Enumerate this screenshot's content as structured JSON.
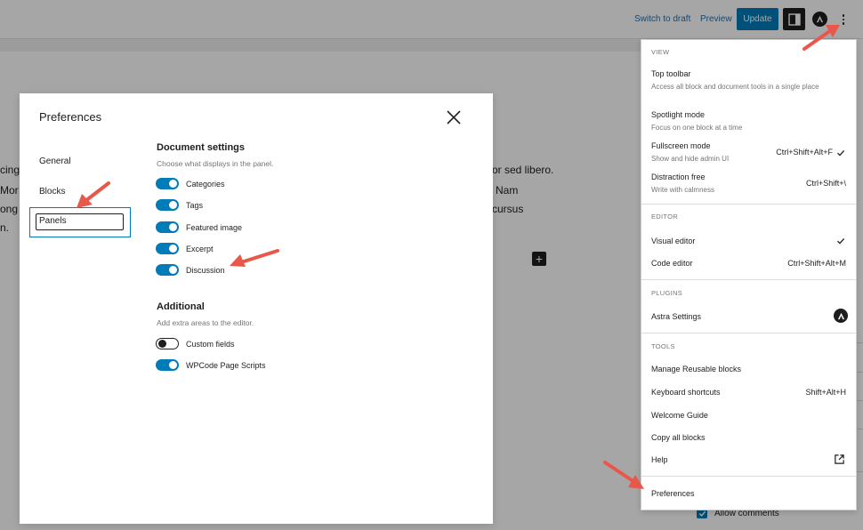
{
  "topbar": {
    "switch_to_draft": "Switch to draft",
    "preview": "Preview",
    "update": "Update"
  },
  "canvas": {
    "left_fragments": [
      "cing",
      "Mor",
      "ong",
      "n."
    ],
    "right_fragments": [
      "or sed libero.",
      "Nam",
      "cursus"
    ],
    "allow_comments": "Allow comments"
  },
  "modal": {
    "title": "Preferences",
    "nav": {
      "general": "General",
      "blocks": "Blocks",
      "panels": "Panels"
    },
    "document_settings": {
      "title": "Document settings",
      "description": "Choose what displays in the panel.",
      "toggles": [
        {
          "label": "Categories",
          "on": true
        },
        {
          "label": "Tags",
          "on": true
        },
        {
          "label": "Featured image",
          "on": true
        },
        {
          "label": "Excerpt",
          "on": true
        },
        {
          "label": "Discussion",
          "on": true
        }
      ]
    },
    "additional": {
      "title": "Additional",
      "description": "Add extra areas to the editor.",
      "toggles": [
        {
          "label": "Custom fields",
          "on": false
        },
        {
          "label": "WPCode Page Scripts",
          "on": true
        }
      ]
    }
  },
  "menu": {
    "view": {
      "heading": "VIEW",
      "top_toolbar": "Top toolbar",
      "top_toolbar_desc": "Access all block and document tools in a single place",
      "spotlight": "Spotlight mode",
      "spotlight_desc": "Focus on one block at a time",
      "fullscreen": "Fullscreen mode",
      "fullscreen_desc": "Show and hide admin UI",
      "fullscreen_shortcut": "Ctrl+Shift+Alt+F",
      "distraction": "Distraction free",
      "distraction_desc": "Write with calmness",
      "distraction_shortcut": "Ctrl+Shift+\\"
    },
    "editor": {
      "heading": "EDITOR",
      "visual": "Visual editor",
      "code": "Code editor",
      "code_shortcut": "Ctrl+Shift+Alt+M"
    },
    "plugins": {
      "heading": "PLUGINS",
      "astra": "Astra Settings"
    },
    "tools": {
      "heading": "TOOLS",
      "reusable": "Manage Reusable blocks",
      "shortcuts": "Keyboard shortcuts",
      "shortcuts_key": "Shift+Alt+H",
      "welcome": "Welcome Guide",
      "copy": "Copy all blocks",
      "help": "Help"
    },
    "preferences": "Preferences"
  },
  "colors": {
    "accent": "#007cba",
    "arrow": "#e8574a",
    "dark": "#1e1e1e"
  }
}
